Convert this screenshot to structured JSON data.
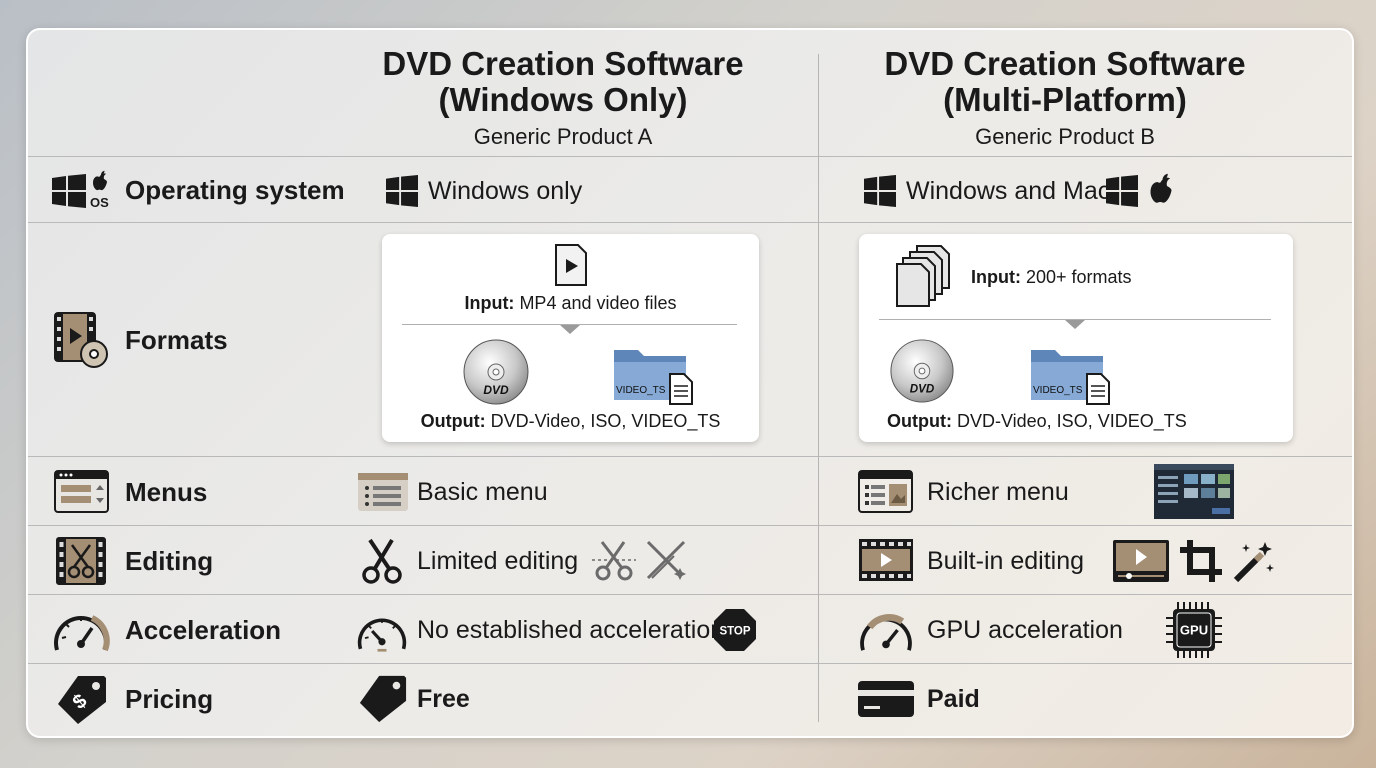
{
  "columns": {
    "a": {
      "title_line1": "DVD Creation Software",
      "title_line2": "(Windows Only)",
      "subtitle": "Generic Product A"
    },
    "b": {
      "title_line1": "DVD Creation Software",
      "title_line2": "(Multi-Platform)",
      "subtitle": "Generic Product B"
    }
  },
  "rows": {
    "os": {
      "label": "Operating system",
      "icon_text": "OS",
      "a": "Windows only",
      "b": "Windows and Mac"
    },
    "formats": {
      "label": "Formats",
      "a": {
        "input_label": "Input:",
        "input_value": " MP4 and video files",
        "output_label": "Output:",
        "output_value": " DVD-Video, ISO, VIDEO_TS",
        "dvd_text": "DVD",
        "folder_text": "VIDEO_TS"
      },
      "b": {
        "input_label": "Input:",
        "input_value": " 200+ formats",
        "output_label": "Output:",
        "output_value": " DVD-Video, ISO, VIDEO_TS",
        "dvd_text": "DVD",
        "folder_text": "VIDEO_TS"
      }
    },
    "menus": {
      "label": "Menus",
      "a": "Basic menu",
      "b": "Richer menu"
    },
    "editing": {
      "label": "Editing",
      "a": "Limited editing",
      "b": "Built-in editing"
    },
    "acceleration": {
      "label": "Acceleration",
      "a": "No established acceleration",
      "a_badge": "STOP",
      "b": "GPU acceleration",
      "b_chip": "GPU"
    },
    "pricing": {
      "label": "Pricing",
      "icon_text": "$",
      "a": "Free",
      "b": "Paid"
    }
  },
  "icons": [
    "windows-logo-icon",
    "apple-logo-icon",
    "film-disc-icon",
    "menu-window-icon",
    "film-scissors-icon",
    "speedometer-icon",
    "price-tag-icon",
    "document-play-icon",
    "documents-stack-icon",
    "dvd-disc-icon",
    "folder-icon",
    "menu-list-icon",
    "scissors-icon",
    "crossed-tools-icon",
    "rich-menu-icon",
    "menu-preview-thumbnail",
    "filmstrip-icon",
    "video-player-icon",
    "crop-icon",
    "magic-wand-icon",
    "stop-sign-icon",
    "gpu-chip-icon",
    "credit-card-icon"
  ],
  "colors": {
    "accent_tan": "#a58f74",
    "dark": "#1a1a1a",
    "line": "#b9b9b9"
  }
}
